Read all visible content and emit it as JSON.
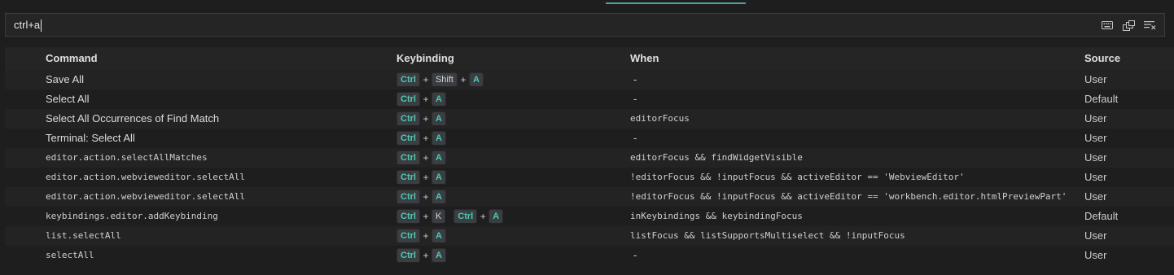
{
  "search": {
    "value": "ctrl+a"
  },
  "search_actions": [
    {
      "icon": "keyboard-icon",
      "name": "record-keys-icon"
    },
    {
      "icon": "sort-by-precedence-icon",
      "name": "sort-precedence-icon"
    },
    {
      "icon": "clear-search-icon",
      "name": "clear-search-icon"
    }
  ],
  "columns": {
    "command": "Command",
    "keybinding": "Keybinding",
    "when": "When",
    "source": "Source"
  },
  "rows": [
    {
      "command": "Save All",
      "command_is_id": false,
      "keys": [
        [
          "Ctrl",
          "Shift",
          "A"
        ]
      ],
      "when": "-",
      "source": "User"
    },
    {
      "command": "Select All",
      "command_is_id": false,
      "keys": [
        [
          "Ctrl",
          "A"
        ]
      ],
      "when": "-",
      "source": "Default"
    },
    {
      "command": "Select All Occurrences of Find Match",
      "command_is_id": false,
      "keys": [
        [
          "Ctrl",
          "A"
        ]
      ],
      "when": "editorFocus",
      "source": "User"
    },
    {
      "command": "Terminal: Select All",
      "command_is_id": false,
      "keys": [
        [
          "Ctrl",
          "A"
        ]
      ],
      "when": "-",
      "source": "User"
    },
    {
      "command": "editor.action.selectAllMatches",
      "command_is_id": true,
      "keys": [
        [
          "Ctrl",
          "A"
        ]
      ],
      "when": "editorFocus && findWidgetVisible",
      "source": "User"
    },
    {
      "command": "editor.action.webvieweditor.selectAll",
      "command_is_id": true,
      "keys": [
        [
          "Ctrl",
          "A"
        ]
      ],
      "when": "!editorFocus && !inputFocus && activeEditor == 'WebviewEditor'",
      "source": "User"
    },
    {
      "command": "editor.action.webvieweditor.selectAll",
      "command_is_id": true,
      "keys": [
        [
          "Ctrl",
          "A"
        ]
      ],
      "when": "!editorFocus && !inputFocus && activeEditor == 'workbench.editor.htmlPreviewPart'",
      "source": "User"
    },
    {
      "command": "keybindings.editor.addKeybinding",
      "command_is_id": true,
      "keys": [
        [
          "Ctrl",
          "K"
        ],
        [
          "Ctrl",
          "A"
        ]
      ],
      "when": "inKeybindings && keybindingFocus",
      "source": "Default"
    },
    {
      "command": "list.selectAll",
      "command_is_id": true,
      "keys": [
        [
          "Ctrl",
          "A"
        ]
      ],
      "when": "listFocus && listSupportsMultiselect && !inputFocus",
      "source": "User"
    },
    {
      "command": "selectAll",
      "command_is_id": true,
      "keys": [
        [
          "Ctrl",
          "A"
        ]
      ],
      "when": "-",
      "source": "User"
    }
  ],
  "highlight_keys": [
    "Ctrl",
    "A"
  ],
  "colors": {
    "background": "#1e1e1e",
    "highlight": "#4ec9b0",
    "accent": "#4aa3a0"
  }
}
